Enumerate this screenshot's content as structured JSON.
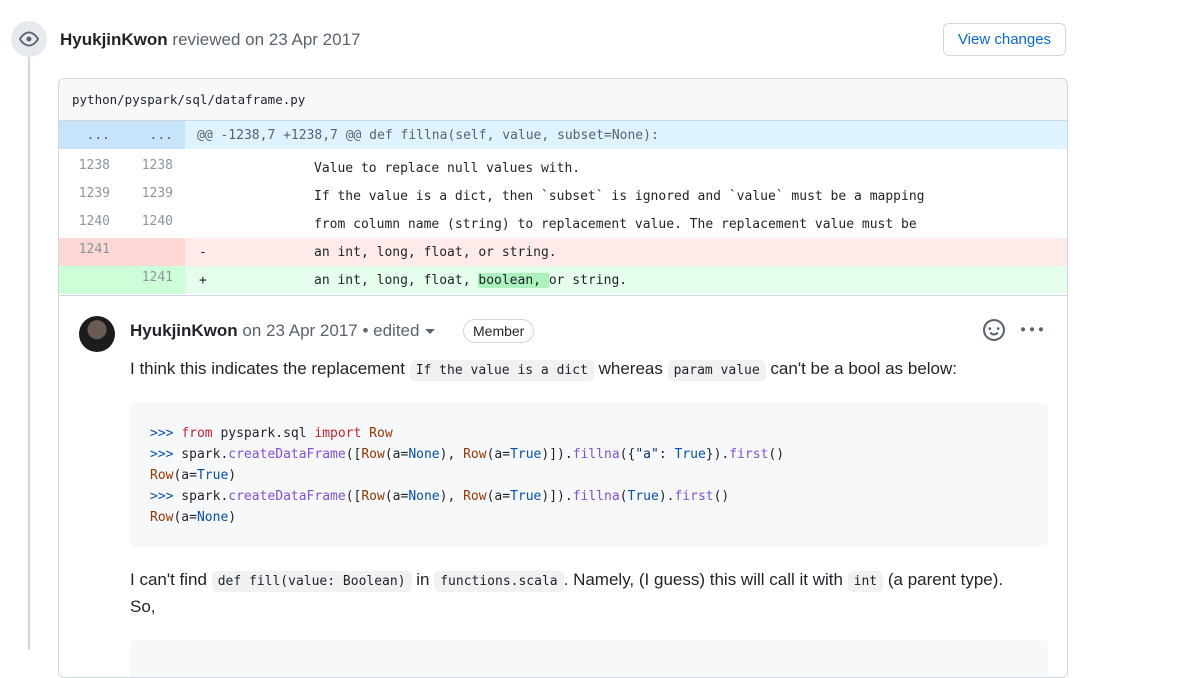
{
  "review": {
    "author": "HyukjinKwon",
    "action": "reviewed on 23 Apr 2017",
    "view_changes_label": "View changes"
  },
  "file": {
    "path": "python/pyspark/sql/dataframe.py"
  },
  "diff": {
    "hunk": {
      "old": "...",
      "new": "...",
      "text": "@@ -1238,7 +1238,7 @@ def fillna(self, value, subset=None):"
    },
    "rows": [
      {
        "old": "1238",
        "new": "1238",
        "sign": "",
        "text": "Value to replace null values with."
      },
      {
        "old": "1239",
        "new": "1239",
        "sign": "",
        "text": "If the value is a dict, then `subset` is ignored and `value` must be a mapping"
      },
      {
        "old": "1240",
        "new": "1240",
        "sign": "",
        "text": "from column name (string) to replacement value. The replacement value must be"
      },
      {
        "old": "1241",
        "new": "",
        "sign": "-",
        "text": "an int, long, float, or string."
      },
      {
        "old": "",
        "new": "1241",
        "sign": "+",
        "text_before": "an int, long, float, ",
        "text_highlight": "boolean, ",
        "text_after": "or string."
      }
    ]
  },
  "comment": {
    "author": "HyukjinKwon",
    "meta": "on 23 Apr 2017 • edited",
    "badge": "Member",
    "p1": {
      "a": "I think this indicates the replacement ",
      "code1": "If the value is a dict",
      "b": " whereas ",
      "code2": "param value",
      "c": " can't be a bool as below:"
    },
    "code_lines": {
      "l1": {
        "prompt": ">>>",
        "kw1": "from",
        "mod": " pyspark.sql ",
        "kw2": "import",
        "cls": " Row"
      },
      "l2": {
        "prompt": ">>>",
        "a": " spark.",
        "fn": "createDataFrame",
        "b": "([",
        "cls1": "Row",
        "c": "(a=",
        "const1": "None",
        "d": "), ",
        "cls2": "Row",
        "e": "(a=",
        "const2": "True",
        "f": ")]).",
        "fn2": "fillna",
        "g": "({",
        "str": "\"a\"",
        "h": ": ",
        "const3": "True",
        "i": "}).",
        "fn3": "first",
        "j": "()"
      },
      "l3": {
        "cls": "Row",
        "a": "(a=",
        "const": "True",
        "b": ")"
      },
      "l4": {
        "prompt": ">>>",
        "a": " spark.",
        "fn": "createDataFrame",
        "b": "([",
        "cls1": "Row",
        "c": "(a=",
        "const1": "None",
        "d": "), ",
        "cls2": "Row",
        "e": "(a=",
        "const2": "True",
        "f": ")]).",
        "fn2": "fillna",
        "g": "(",
        "const3": "True",
        "h": ").",
        "fn3": "first",
        "i": "()"
      },
      "l5": {
        "cls": "Row",
        "a": "(a=",
        "const": "None",
        "b": ")"
      }
    },
    "p2": {
      "a": "I can't find ",
      "code1": "def fill(value: Boolean)",
      "b": " in ",
      "code2": "functions.scala",
      "c": ". Namely, (I guess) this will call it with ",
      "code3": "int",
      "d": " (a parent type)."
    },
    "p3": "So,"
  },
  "icons": {
    "eye": "eye-icon",
    "smile": "smiley-icon",
    "more": "kebab-horizontal-icon",
    "caret": "caret-down-icon"
  },
  "colors": {
    "accent": "#0969da",
    "del_bg": "#ffebe9",
    "add_bg": "#e6ffec",
    "hunk_bg": "#ddf4ff"
  }
}
